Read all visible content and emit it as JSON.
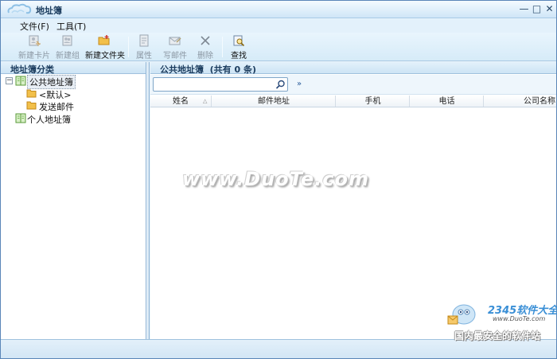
{
  "window": {
    "title": "地址簿"
  },
  "menu": [
    {
      "label": "文件(F)"
    },
    {
      "label": "工具(T)"
    }
  ],
  "toolbar": {
    "new_card": "新建卡片",
    "new_group": "新建组",
    "new_folder": "新建文件夹",
    "properties": "属性",
    "write_mail": "写邮件",
    "delete": "删除",
    "find": "查找"
  },
  "left_panel": {
    "header": "地址簿分类",
    "tree": {
      "public": "公共地址簿",
      "default": "<默认>",
      "sent_mail": "发送邮件",
      "personal": "个人地址簿"
    }
  },
  "right_panel": {
    "header": "公共地址簿  (共有 0 条)",
    "search": {
      "value": "",
      "placeholder": ""
    },
    "columns": [
      "姓名",
      "邮件地址",
      "手机",
      "电话",
      "公司名称"
    ]
  },
  "watermark": {
    "center": "www.DuoTe.com",
    "brand": "2345软件大全",
    "url": "www.DuoTe.com",
    "slogan": "国内最安全的软件站"
  },
  "colors": {
    "accent_border": "#5a86b8",
    "toolbar_bg": "#d6ebf8",
    "folder": "#f2c04a"
  }
}
